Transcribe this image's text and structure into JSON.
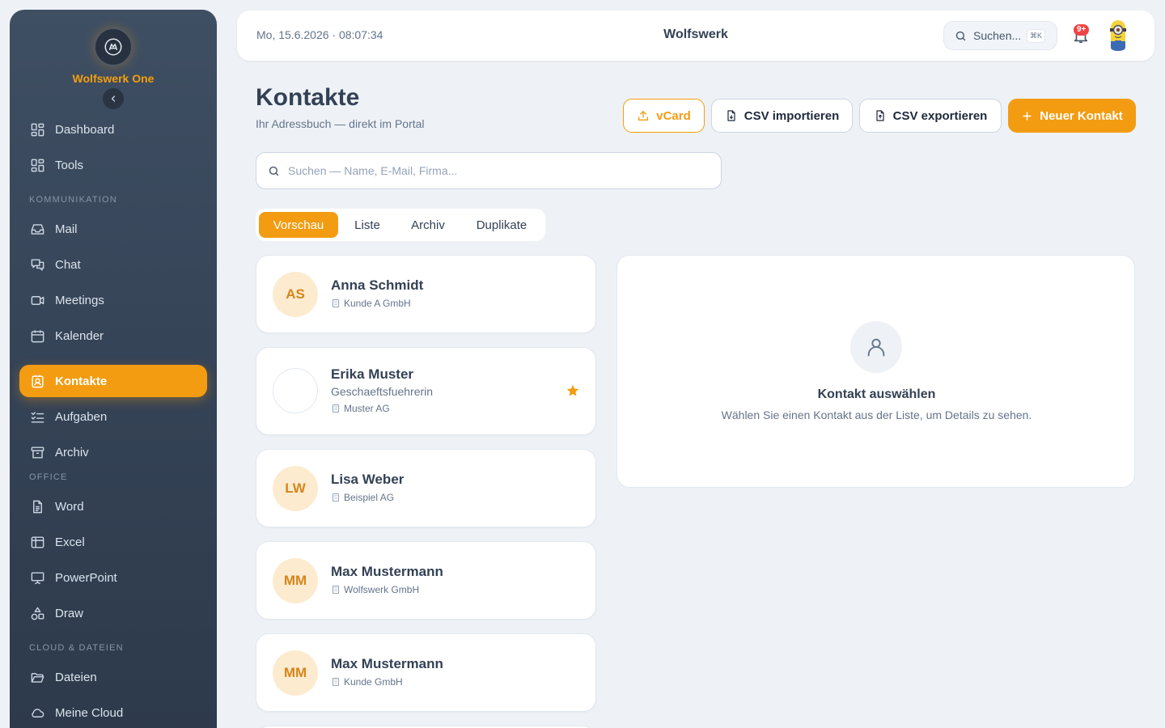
{
  "sidebar": {
    "brand_name": "Wolfswerk One",
    "sections": {
      "kommunikation": "KOMMUNIKATION",
      "office": "OFFICE",
      "cloud": "CLOUD & DATEIEN"
    },
    "items": {
      "dashboard": "Dashboard",
      "tools": "Tools",
      "mail": "Mail",
      "chat": "Chat",
      "meetings": "Meetings",
      "kalender": "Kalender",
      "kontakte": "Kontakte",
      "aufgaben": "Aufgaben",
      "archiv": "Archiv",
      "word": "Word",
      "excel": "Excel",
      "powerpoint": "PowerPoint",
      "draw": "Draw",
      "dateien": "Dateien",
      "cloud": "Meine Cloud"
    },
    "active_item": "kontakte"
  },
  "topbar": {
    "datetime": "Mo, 15.6.2026 · 08:07:34",
    "title": "Wolfswerk",
    "search_label": "Suchen...",
    "search_shortcut": "⌘K",
    "notification_badge": "9+"
  },
  "page": {
    "title": "Kontakte",
    "subtitle": "Ihr Adressbuch — direkt im Portal",
    "buttons": {
      "vcard": "vCard",
      "csv_import": "CSV importieren",
      "csv_export": "CSV exportieren",
      "new_contact": "Neuer Kontakt"
    },
    "search_placeholder": "Suchen — Name, E-Mail, Firma...",
    "tabs": {
      "vorschau": "Vorschau",
      "liste": "Liste",
      "archiv": "Archiv",
      "duplikate": "Duplikate"
    },
    "active_tab": "vorschau"
  },
  "contacts": [
    {
      "initials": "AS",
      "name": "Anna Schmidt",
      "role": "",
      "company": "Kunde A GmbH",
      "favorite": false
    },
    {
      "initials": "",
      "name": "Erika Muster",
      "role": "Geschaeftsfuehrerin",
      "company": "Muster AG",
      "favorite": true
    },
    {
      "initials": "LW",
      "name": "Lisa Weber",
      "role": "",
      "company": "Beispiel AG",
      "favorite": false
    },
    {
      "initials": "MM",
      "name": "Max Mustermann",
      "role": "",
      "company": "Wolfswerk GmbH",
      "favorite": false
    },
    {
      "initials": "MM",
      "name": "Max Mustermann",
      "role": "",
      "company": "Kunde GmbH",
      "favorite": false
    }
  ],
  "detail": {
    "title": "Kontakt auswählen",
    "text": "Wählen Sie einen Kontakt aus der Liste, um Details zu sehen."
  },
  "colors": {
    "accent": "#f39c12",
    "sidebar_bg": "#3a485b",
    "page_bg": "#eef2f7",
    "avatar_bg": "#fdebd0",
    "badge": "#ef4444"
  },
  "icons": {
    "dashboard": "grid-icon",
    "tools": "grid-icon",
    "mail": "inbox-icon",
    "chat": "chat-bubbles-icon",
    "meetings": "video-camera-icon",
    "kalender": "calendar-icon",
    "kontakte": "contact-card-icon",
    "aufgaben": "checklist-icon",
    "archiv": "archive-box-icon",
    "word": "document-icon",
    "excel": "table-icon",
    "powerpoint": "presentation-icon",
    "draw": "shapes-icon",
    "dateien": "folder-open-icon",
    "cloud": "cloud-icon"
  }
}
